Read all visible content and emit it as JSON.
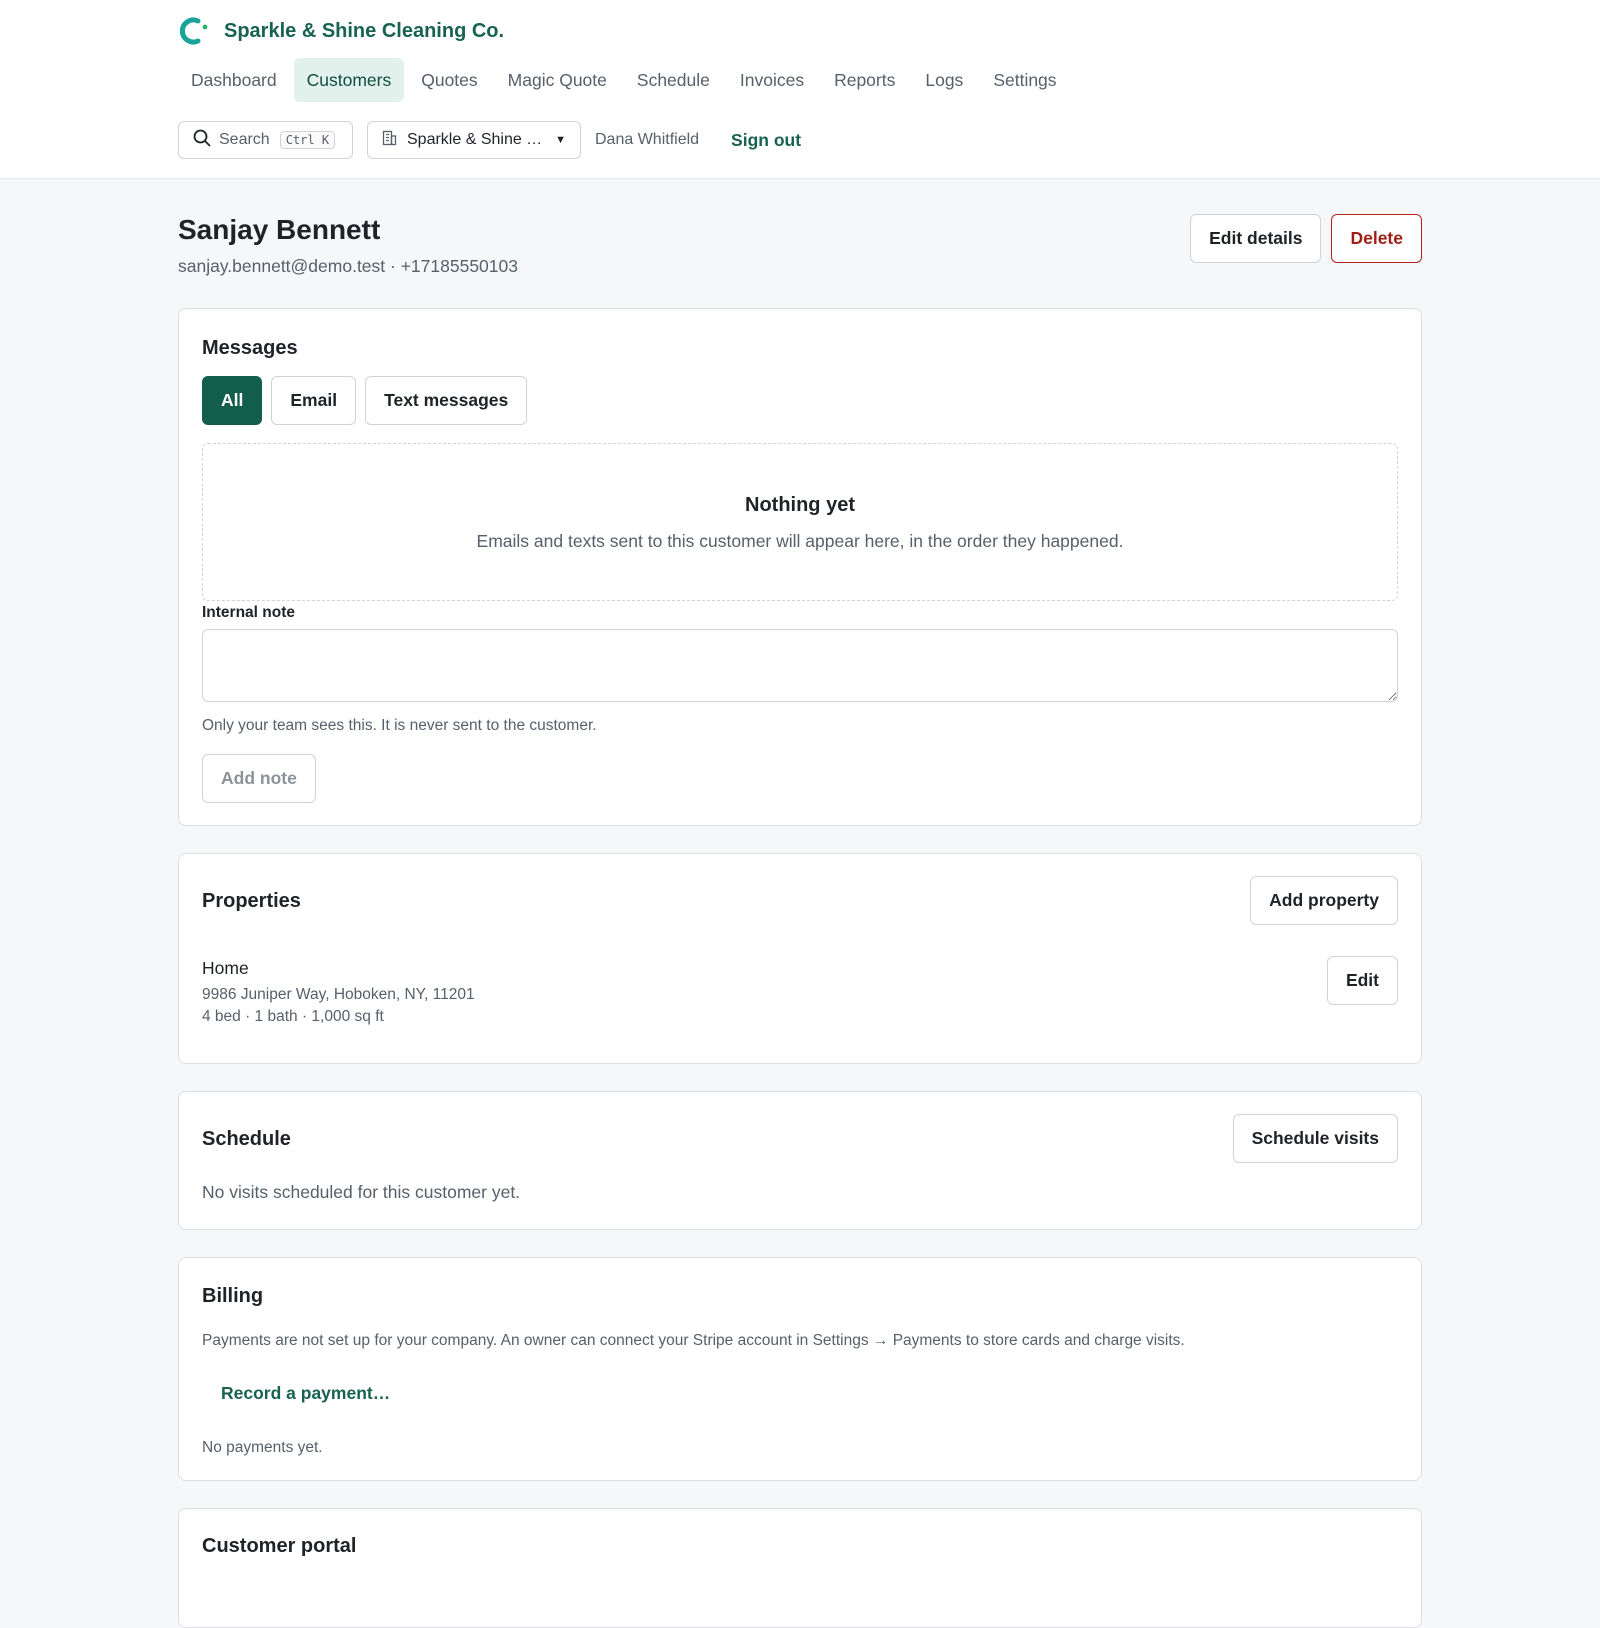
{
  "brand": {
    "name": "Sparkle & Shine Cleaning Co."
  },
  "nav": {
    "items": [
      {
        "label": "Dashboard"
      },
      {
        "label": "Customers"
      },
      {
        "label": "Quotes"
      },
      {
        "label": "Magic Quote"
      },
      {
        "label": "Schedule"
      },
      {
        "label": "Invoices"
      },
      {
        "label": "Reports"
      },
      {
        "label": "Logs"
      },
      {
        "label": "Settings"
      }
    ],
    "active": "Customers"
  },
  "toolbar": {
    "search_label": "Search",
    "search_shortcut": "Ctrl K",
    "company_selected": "Sparkle & Shine …",
    "user_name": "Dana Whitfield",
    "sign_out": "Sign out"
  },
  "customer": {
    "name": "Sanjay Bennett",
    "contact": "sanjay.bennett@demo.test · +17185550103",
    "edit_label": "Edit details",
    "delete_label": "Delete"
  },
  "messages": {
    "title": "Messages",
    "tabs": [
      {
        "label": "All"
      },
      {
        "label": "Email"
      },
      {
        "label": "Text messages"
      }
    ],
    "active_tab": "All",
    "empty_title": "Nothing yet",
    "empty_text": "Emails and texts sent to this customer will appear here, in the order they happened.",
    "note_label": "Internal note",
    "note_value": "",
    "note_hint": "Only your team sees this. It is never sent to the customer.",
    "add_note_label": "Add note"
  },
  "properties": {
    "title": "Properties",
    "add_label": "Add property",
    "items": [
      {
        "name": "Home",
        "address": "9986 Juniper Way, Hoboken, NY, 11201",
        "details": "4 bed · 1 bath · 1,000 sq ft",
        "edit_label": "Edit"
      }
    ]
  },
  "schedule": {
    "title": "Schedule",
    "action_label": "Schedule visits",
    "empty_text": "No visits scheduled for this customer yet."
  },
  "billing": {
    "title": "Billing",
    "notice": "Payments are not set up for your company. An owner can connect your Stripe account in Settings → Payments to store cards and charge visits.",
    "record_label": "Record a payment…",
    "empty_text": "No payments yet."
  },
  "portal": {
    "title": "Customer portal"
  },
  "colors": {
    "brand": "#17634f",
    "active_tab": "#135e4b",
    "danger": "#b42318",
    "page_bg": "#f6f7f9"
  }
}
